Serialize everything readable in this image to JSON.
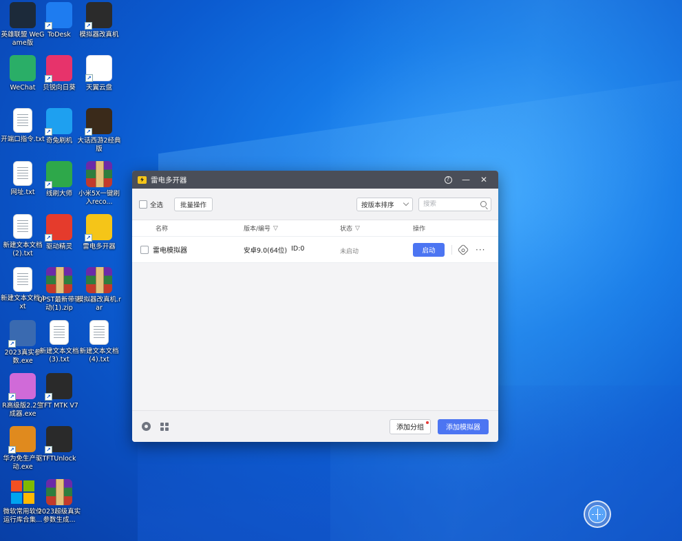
{
  "desktop": {
    "icons": [
      {
        "label": "英雄联盟\nWeGame版",
        "icon": "league-of-legends-icon",
        "color": "#1c2a3a"
      },
      {
        "label": "ToDesk",
        "icon": "todesk-icon",
        "color": "#1e7cf0"
      },
      {
        "label": "模拟器改真机",
        "icon": "folder-app-icon",
        "color": "#2b2b2b"
      },
      {
        "label": "WeChat",
        "icon": "wechat-icon",
        "color": "#2aae67"
      },
      {
        "label": "贝锐向日葵",
        "icon": "sunflower-icon",
        "color": "#e7336b"
      },
      {
        "label": "天翼云盘",
        "icon": "tianyi-cloud-icon",
        "color": "#ffffff"
      },
      {
        "label": "开端口指令.txt",
        "icon": "text-file-icon",
        "color": "#ffffff"
      },
      {
        "label": "奇兔刷机",
        "icon": "rabbit-icon",
        "color": "#1ea0f0"
      },
      {
        "label": "大话西游2经典版",
        "icon": "game-icon",
        "color": "#3a2a1a"
      },
      {
        "label": "网址.txt",
        "icon": "text-file-icon",
        "color": "#ffffff"
      },
      {
        "label": "线刷大师",
        "icon": "android-icon",
        "color": "#2ea84a"
      },
      {
        "label": "小米5X一键刷入reco...",
        "icon": "archive-icon",
        "color": "#6b2aa8"
      },
      {
        "label": "新建文本文档(2).txt",
        "icon": "text-file-icon",
        "color": "#ffffff"
      },
      {
        "label": "驱动精灵",
        "icon": "driver-icon",
        "color": "#e53b2c"
      },
      {
        "label": "雷电多开器",
        "icon": "ldplayer-icon",
        "color": "#f5c518"
      },
      {
        "label": "新建文本文档.txt",
        "icon": "text-file-icon",
        "color": "#ffffff"
      },
      {
        "label": "QPST最新带驱动(1).zip",
        "icon": "archive-icon",
        "color": "#6b2aa8"
      },
      {
        "label": "模拟器改真机.rar",
        "icon": "archive-icon",
        "color": "#6b2aa8"
      },
      {
        "label": "2023真实参数.exe",
        "icon": "gear-app-icon",
        "color": "#3a6ab0"
      },
      {
        "label": "新建文本文档(3).txt",
        "icon": "text-file-icon",
        "color": "#ffffff"
      },
      {
        "label": "新建文本文档(4).txt",
        "icon": "text-file-icon",
        "color": "#ffffff"
      },
      {
        "label": "R高级版2.2生成器.exe",
        "icon": "touch-icon",
        "color": "#d06ad8"
      },
      {
        "label": "TFT MTK V7",
        "icon": "spider-icon",
        "color": "#2a2a2a"
      },
      {
        "label": "华为免生产驱动.exe",
        "icon": "blocks-icon",
        "color": "#e08a1e"
      },
      {
        "label": "TFTUnlock",
        "icon": "spider-gold-icon",
        "color": "#2a2a2a"
      },
      {
        "label": "微软常用软件运行库合集...",
        "icon": "windows-icon",
        "color": "#f25022"
      },
      {
        "label": "2023超级真实参数生成...",
        "icon": "archive-icon",
        "color": "#6b2aa8"
      }
    ]
  },
  "window": {
    "title": "雷电多开器",
    "help_glyph": "?",
    "minimize_glyph": "—",
    "close_glyph": "✕",
    "toolbar": {
      "select_all": "全选",
      "batch_ops": "批量操作",
      "sort_value": "按版本排序",
      "search_placeholder": "搜索"
    },
    "columns": {
      "name": "名称",
      "version": "版本/编号",
      "status": "状态",
      "actions": "操作"
    },
    "rows": [
      {
        "name": "雷电模拟器",
        "version": "安卓9.0(64位)",
        "id": "ID:0",
        "status": "未启动",
        "action": "启动",
        "more": "···"
      }
    ],
    "footer": {
      "add_group": "添加分组",
      "add_emulator": "添加模拟器"
    },
    "accent": "#4c75f2",
    "titlebar_color": "#4a4e58"
  }
}
